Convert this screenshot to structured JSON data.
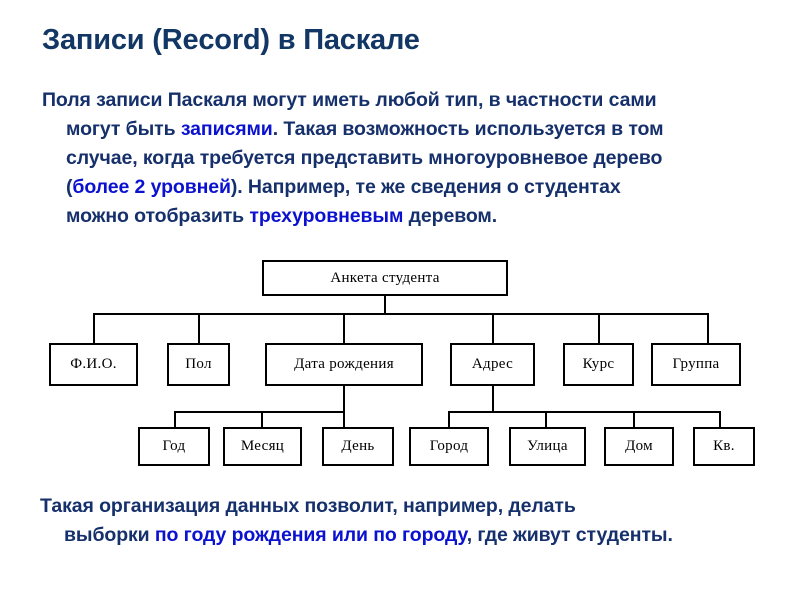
{
  "slide": {
    "title": "Записи (Record) в Паскале",
    "colors": {
      "title": "#123764",
      "body_text": "#16306b",
      "highlight": "#0b12cf",
      "diagram_stroke": "#000000",
      "background": "#ffffff"
    }
  },
  "intro_paragraph": {
    "line1_a": "Поля записи Паскаля могут иметь любой тип, в частности сами",
    "line2_a": "могут быть ",
    "line2_hl": "записями",
    "line2_b": ". Такая возможность используется в том",
    "line3_a": "случае, когда требуется представить многоуровневое дерево",
    "line4_a": "(",
    "line4_hl": "более 2 уровней",
    "line4_b": "). Например, те же сведения о студентах",
    "line5_a": "можно отобразить ",
    "line5_hl": "трехуровневым",
    "line5_b": " деревом."
  },
  "closing_paragraph": {
    "line1": "Такая организация данных позволит, например, делать",
    "line2_a": "выборки ",
    "line2_hl": "по году рождения или по городу",
    "line2_b": ", где живут студенты."
  },
  "diagram": {
    "type": "tree",
    "root": {
      "label": "Анкета студента"
    },
    "level2": [
      {
        "label": "Ф.И.О."
      },
      {
        "label": "Пол"
      },
      {
        "label": "Дата рождения"
      },
      {
        "label": "Адрес"
      },
      {
        "label": "Курс"
      },
      {
        "label": "Группа"
      }
    ],
    "level3_date": [
      {
        "label": "Год"
      },
      {
        "label": "Месяц"
      },
      {
        "label": "День"
      }
    ],
    "level3_address": [
      {
        "label": "Город"
      },
      {
        "label": "Улица"
      },
      {
        "label": "Дом"
      },
      {
        "label": "Кв."
      }
    ]
  }
}
